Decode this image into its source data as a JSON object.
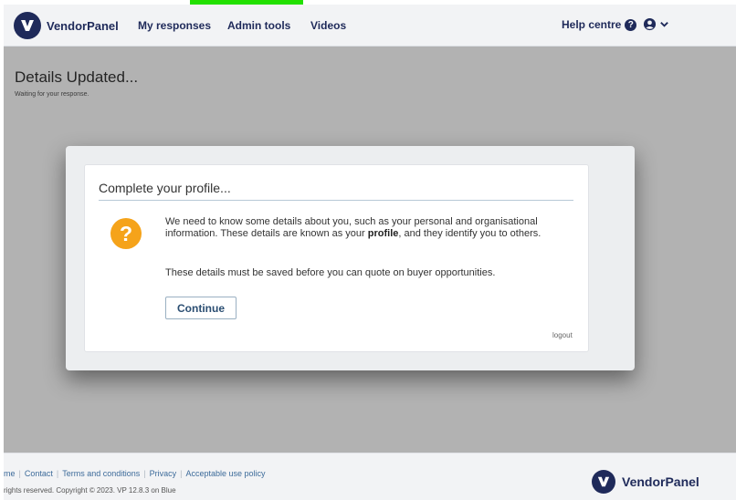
{
  "colors": {
    "brand": "#1f2a5a",
    "accent_green": "#22e000",
    "question_icon": "#f5a31a",
    "link": "#3d6b9a"
  },
  "navbar": {
    "brand_name": "VendorPanel",
    "brand_logo_icon": "vendorpanel-logo-icon",
    "items": [
      {
        "label": "My responses"
      },
      {
        "label": "Admin tools"
      },
      {
        "label": "Videos"
      }
    ],
    "help_label": "Help centre",
    "help_icon": "question-circle-icon",
    "user_icon": "user-circle-icon",
    "user_menu_icon": "chevron-down-icon"
  },
  "page": {
    "title": "Details Updated...",
    "subtitle": "Waiting for your response."
  },
  "modal": {
    "title": "Complete your profile...",
    "icon": "question-icon",
    "icon_glyph": "?",
    "message_before": "We need to know some details about you, such as your personal and organisational information. These details are known as your ",
    "message_bold": "profile",
    "message_after": ", and they identify you to others.",
    "message2": "These details must be saved before you can quote on buyer opportunities.",
    "continue_label": "Continue",
    "logout_label": "logout"
  },
  "footer": {
    "links": [
      {
        "label": "me"
      },
      {
        "label": "Contact"
      },
      {
        "label": "Terms and conditions"
      },
      {
        "label": "Privacy"
      },
      {
        "label": "Acceptable use policy"
      }
    ],
    "copyright": "rights reserved. Copyright © 2023. VP 12.8.3 on Blue",
    "brand_name": "VendorPanel"
  }
}
